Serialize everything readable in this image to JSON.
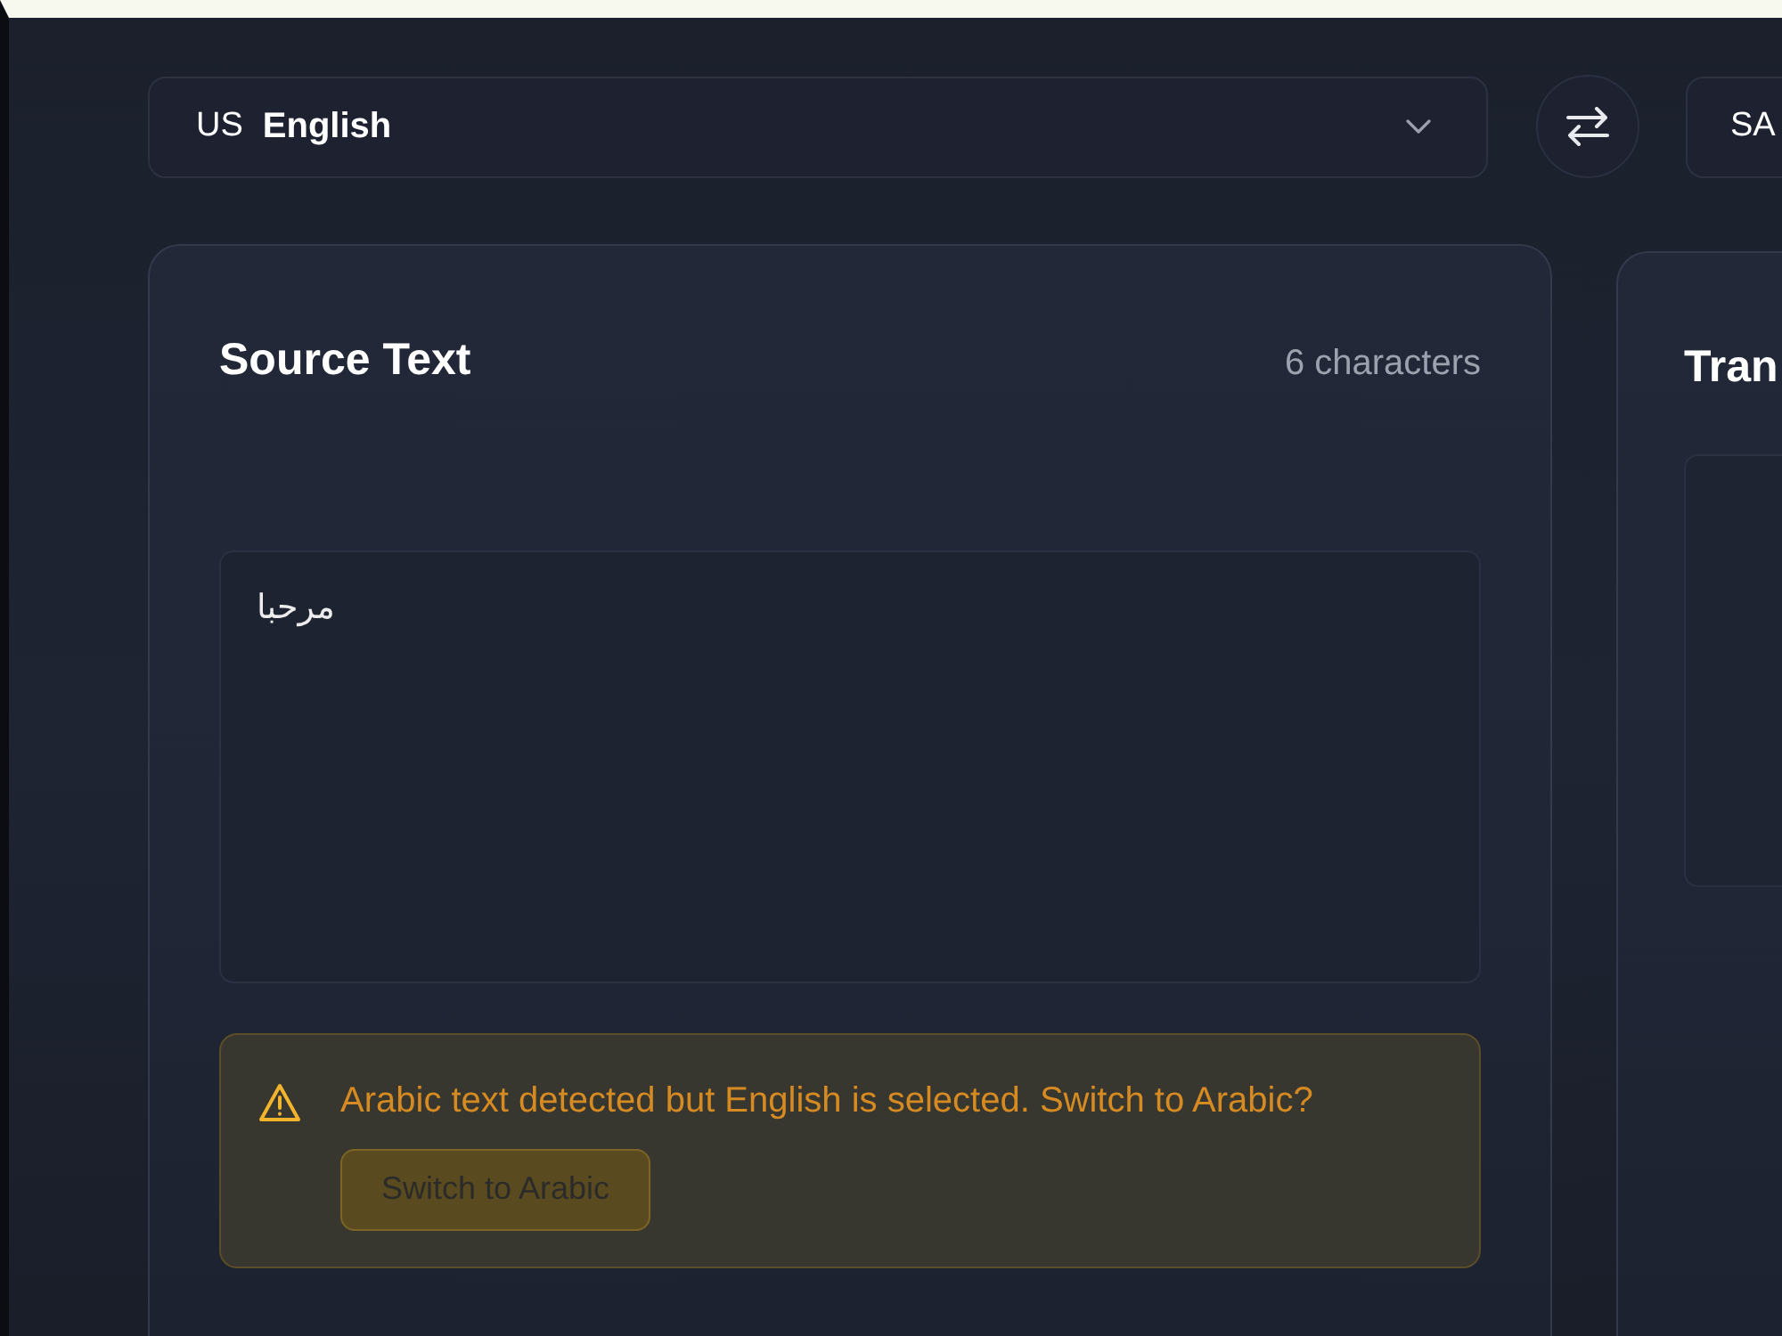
{
  "source_language": {
    "flag": "US",
    "label": "English"
  },
  "target_language": {
    "flag": "SA"
  },
  "source_panel": {
    "title": "Source Text",
    "character_count": "6 characters",
    "text": "مرحبا",
    "warning": {
      "message": "Arabic text detected but English is selected. Switch to Arabic?",
      "button": "Switch to Arabic"
    }
  },
  "target_panel": {
    "title": "Tran"
  }
}
